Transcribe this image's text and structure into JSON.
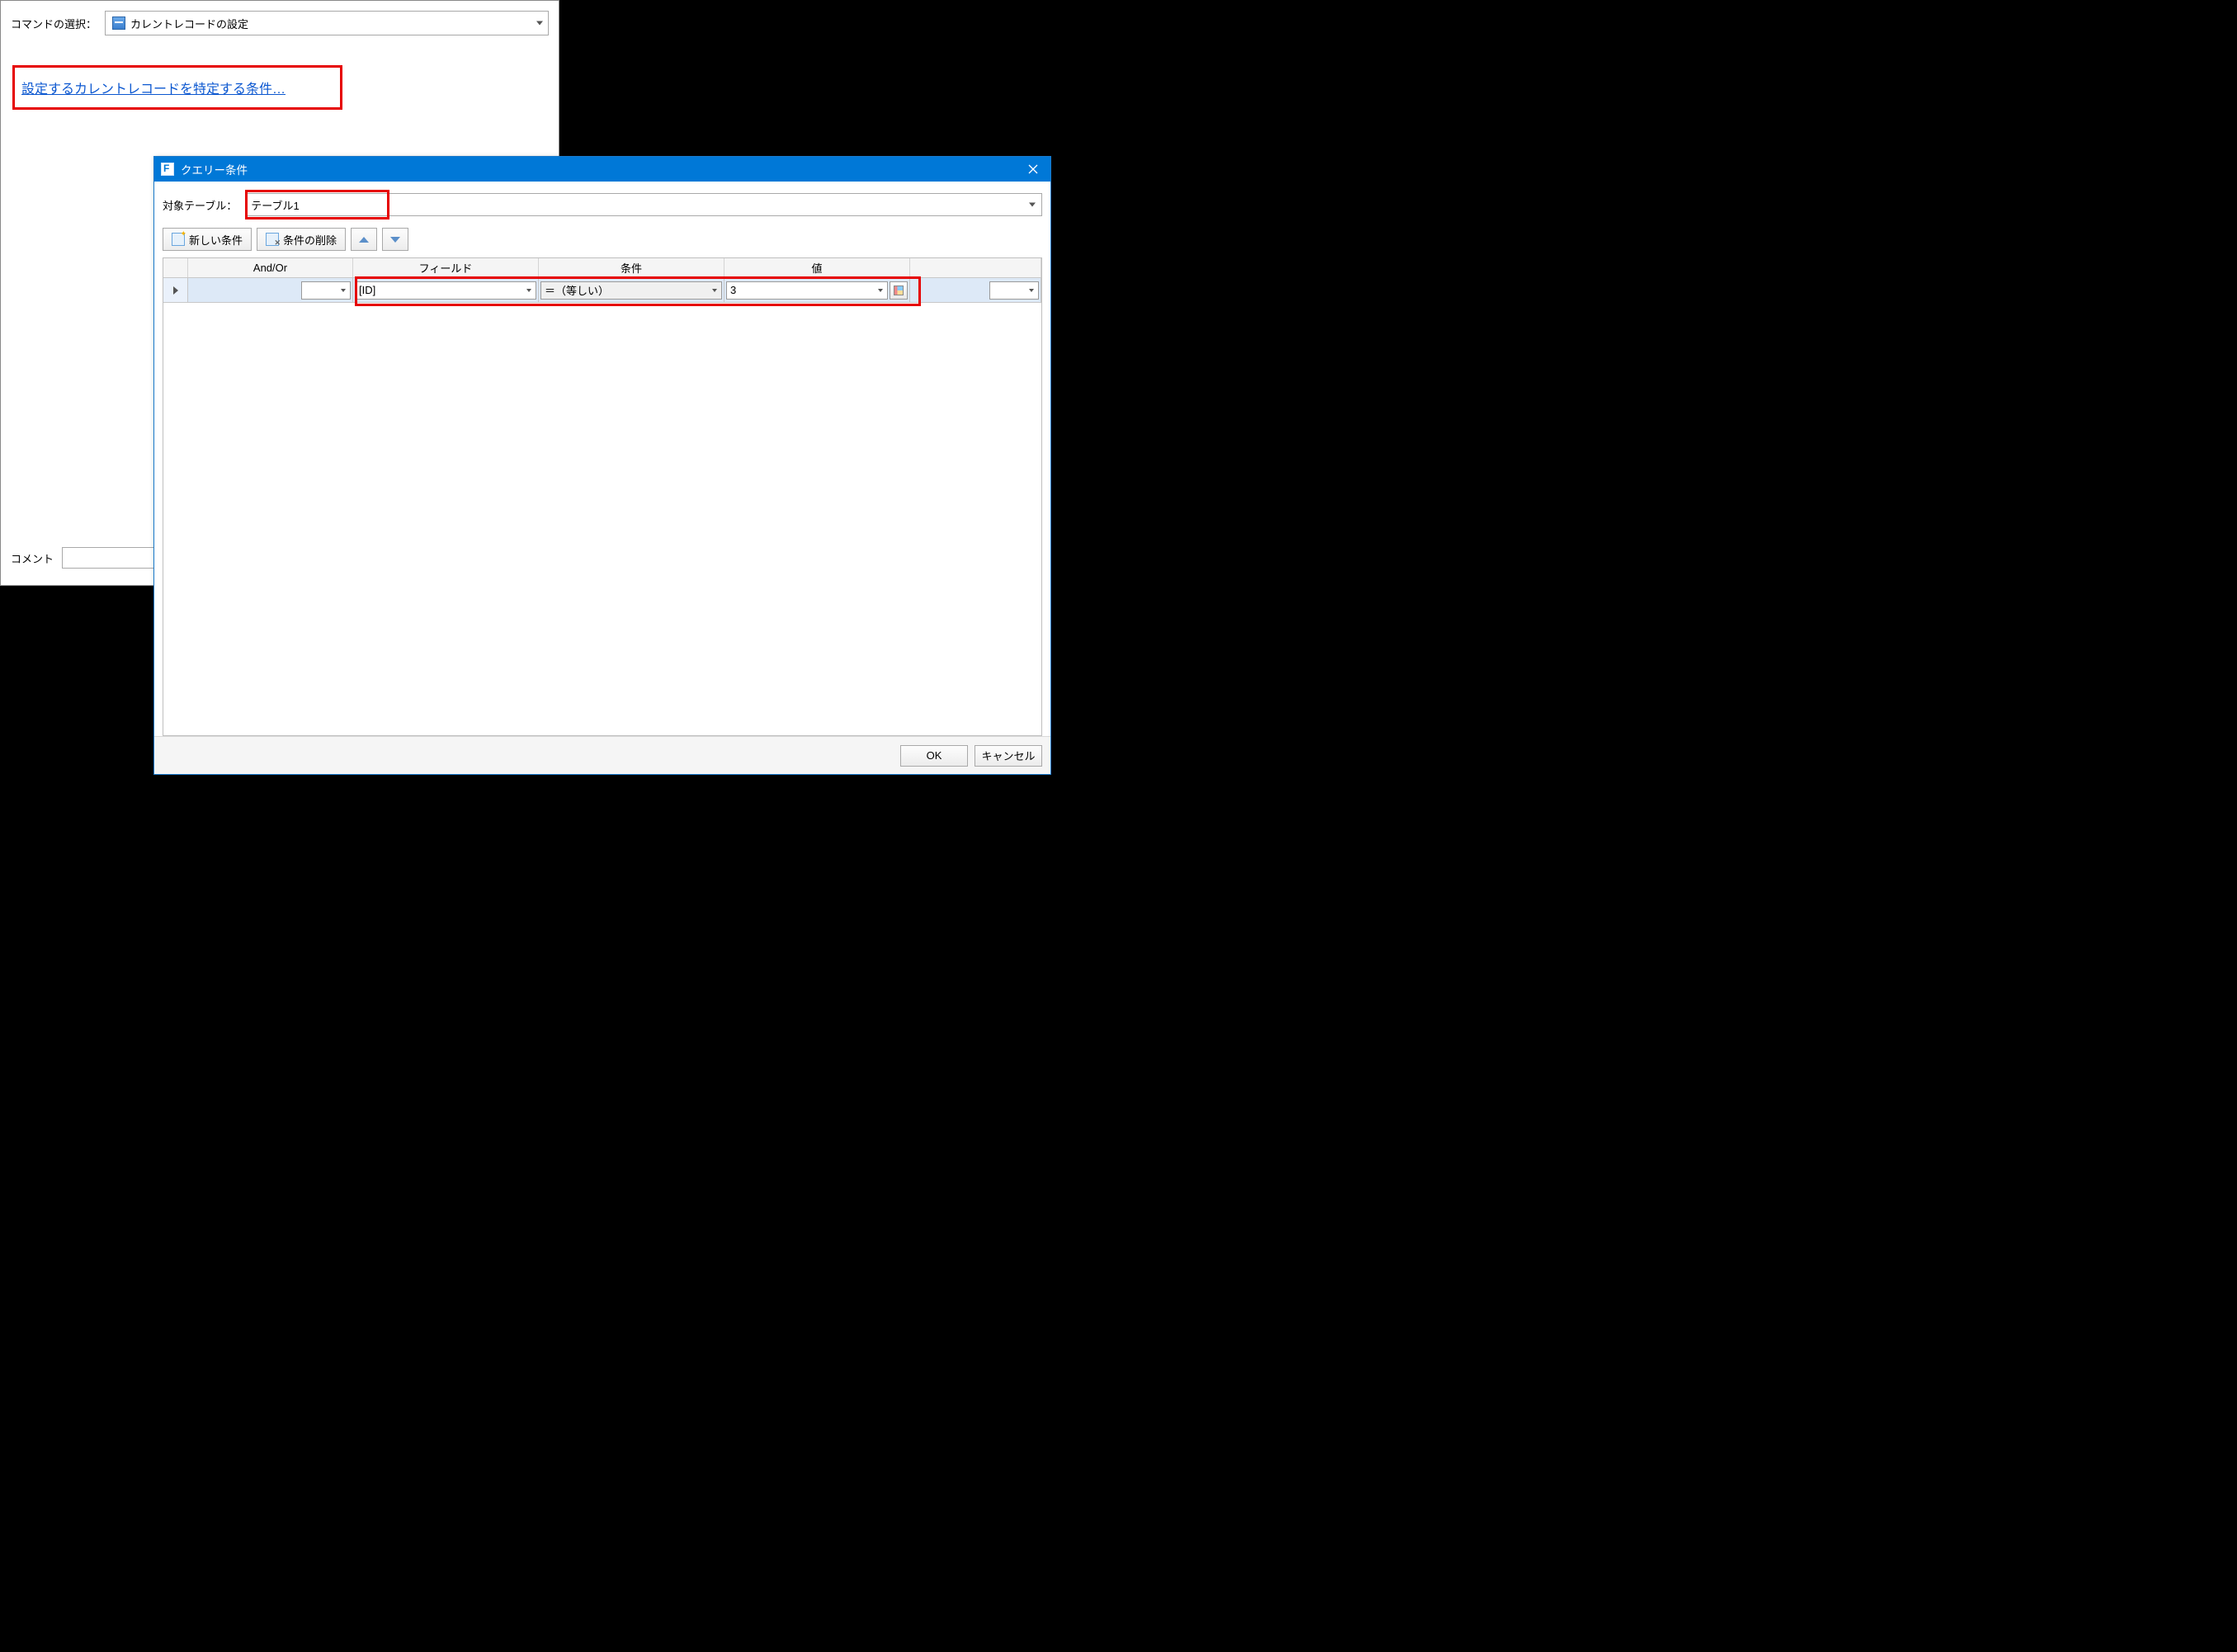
{
  "back": {
    "cmd_label": "コマンドの選択：",
    "cmd_value": "カレントレコードの設定",
    "condition_link": "設定するカレントレコードを特定する条件…",
    "comment_label": "コメント"
  },
  "dialog": {
    "title": "クエリー条件",
    "target_label": "対象テーブル：",
    "target_value": "テーブル1",
    "toolbar": {
      "new_condition": "新しい条件",
      "delete_condition": "条件の削除"
    },
    "grid": {
      "headers": {
        "andor": "And/Or",
        "field": "フィールド",
        "condition": "条件",
        "value": "値"
      },
      "rows": [
        {
          "andor": "",
          "field": "[ID]",
          "condition": "＝（等しい）",
          "value": "3"
        }
      ]
    },
    "footer": {
      "ok": "OK",
      "cancel": "キャンセル"
    }
  }
}
